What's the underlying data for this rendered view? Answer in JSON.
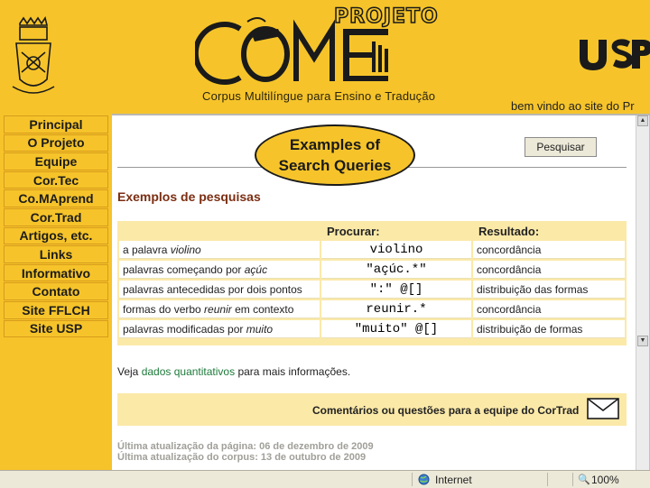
{
  "header": {
    "projeto": "PROJETO",
    "logo_letters": [
      "C",
      "M",
      "ET"
    ],
    "subtitle": "Corpus Multilíngue para Ensino e Tradução",
    "usp_logo": "USP",
    "welcome": "bem vindo ao site do Pr"
  },
  "sidebar": {
    "items": [
      {
        "label": "Principal"
      },
      {
        "label": "O Projeto"
      },
      {
        "label": "Equipe"
      },
      {
        "label": "Cor.Tec"
      },
      {
        "label": "Co.MAprend"
      },
      {
        "label": "Cor.Trad"
      },
      {
        "label": "Artigos, etc."
      },
      {
        "label": "Links"
      },
      {
        "label": "Informativo"
      },
      {
        "label": "Contato"
      },
      {
        "label": "Site FFLCH"
      },
      {
        "label": "Site USP"
      }
    ]
  },
  "main": {
    "search_button": "Pesquisar",
    "section_title": "Exemplos de pesquisas",
    "table": {
      "headers": [
        "Procurar:",
        "Resultado:"
      ],
      "rows": [
        {
          "prefix": "a palavra ",
          "term": "violino",
          "suffix": "",
          "query": "violino",
          "result": "concordância"
        },
        {
          "prefix": "palavras começando por ",
          "term": "açúc",
          "suffix": "",
          "query": "\"açúc.*\"",
          "result": "concordância"
        },
        {
          "prefix": "palavras antecedidas por dois pontos",
          "term": "",
          "suffix": "",
          "query": "\":\" @[]",
          "result": "distribuição das formas"
        },
        {
          "prefix": "formas do verbo ",
          "term": "reunir",
          "suffix": " em contexto",
          "query": "reunir.*",
          "result": "concordância"
        },
        {
          "prefix": "palavras modificadas por ",
          "term": "muito",
          "suffix": "",
          "query": "\"muito\" @[]",
          "result": "distribuição de formas"
        }
      ]
    },
    "more_info": {
      "before": "Veja ",
      "link": "dados quantitativos",
      "after": " para mais informações."
    },
    "comments": "Comentários ou questões para a equipe do CorTrad",
    "update_page": "Última atualização da página: 06 de dezembro de 2009",
    "update_corpus": "Última atualização do corpus: 13 de outubro de 2009"
  },
  "callout": {
    "line1": "Examples of",
    "line2": "Search Queries"
  },
  "statusbar": {
    "zone": "Internet",
    "zoom": "100%"
  },
  "colors": {
    "page_bg": "#f6c42a",
    "table_bg": "#fbe9a8",
    "title": "#7b2e12",
    "link": "#1d7a3a"
  },
  "icons": [
    "crest-logo-icon",
    "comet-mouse-logo-icon",
    "usp-logo-icon",
    "envelope-icon",
    "globe-icon",
    "zoom-icon"
  ]
}
